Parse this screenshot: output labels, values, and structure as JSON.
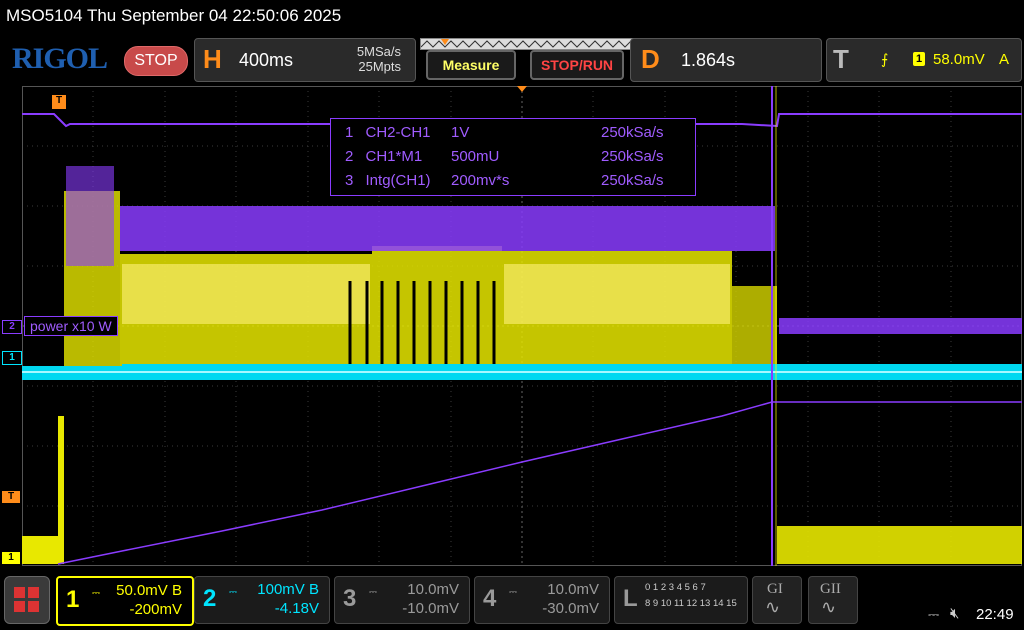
{
  "title": "MSO5104  Thu September 04 22:50:06 2025",
  "brand": "RIGOL",
  "run_state": "STOP",
  "horizontal": {
    "letter": "H",
    "timebase": "400ms",
    "sample_rate": "5MSa/s",
    "memory_depth": "25Mpts"
  },
  "buttons": {
    "measure": "Measure",
    "stop_run": "STOP/RUN"
  },
  "delay": {
    "letter": "D",
    "value": "1.864s"
  },
  "trigger": {
    "letter": "T",
    "source": "1",
    "level": "58.0mV",
    "mode": "A"
  },
  "math": [
    {
      "index": "1",
      "expr": "CH2-CH1",
      "scale": "1V",
      "rate": "250kSa/s"
    },
    {
      "index": "2",
      "expr": "CH1*M1",
      "scale": "500mU",
      "rate": "250kSa/s"
    },
    {
      "index": "3",
      "expr": "Intg(CH1)",
      "scale": "200mv*s",
      "rate": "250kSa/s"
    }
  ],
  "waveform_label": "power x10 W",
  "markers": {
    "trigger_top": "T",
    "ch2": "2",
    "ch1": "1",
    "trig_level": "T",
    "ch1_bottom": "1"
  },
  "channels": [
    {
      "num": "1",
      "scale": "50.0mV",
      "bw": "B",
      "offset": "-200mV",
      "color": "#ffff00"
    },
    {
      "num": "2",
      "scale": "100mV",
      "bw": "B",
      "offset": "-4.18V",
      "color": "#00e5ff"
    },
    {
      "num": "3",
      "scale": "10.0mV",
      "bw": "",
      "offset": "-10.0mV",
      "color": "#9a9a9a"
    },
    {
      "num": "4",
      "scale": "10.0mV",
      "bw": "",
      "offset": "-30.0mV",
      "color": "#9a9a9a"
    }
  ],
  "logic": {
    "letter": "L",
    "row1": "0 1 2 3  4 5 6 7",
    "row2": "8 9 10 11 12 13 14 15"
  },
  "gi": "GI",
  "gii": "GII",
  "clock": "22:49",
  "colors": {
    "ch1": "#ffff00",
    "ch2": "#00e5ff",
    "math": "#8a3cff",
    "accent": "#ff8c1a",
    "stop": "#c84a4a"
  }
}
